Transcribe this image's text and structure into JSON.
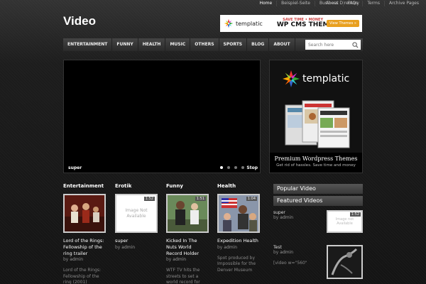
{
  "top_links": [
    "Home",
    "Beispiel-Seite",
    "Business Directory"
  ],
  "top_links_right": [
    "About",
    "FAQs",
    "Terms",
    "Archive Pages"
  ],
  "site_title": "Video",
  "banner": {
    "brand": "templatic",
    "tagline": "SAVE TIME • MONEY",
    "headline": "WP CMS THEM",
    "button": "View Themes »"
  },
  "nav": [
    "ENTERTAINMENT",
    "FUNNY",
    "HEALTH",
    "MUSIC",
    "OTHERS",
    "SPORTS",
    "BLOG",
    "ABOUT"
  ],
  "search": {
    "placeholder": "Search here"
  },
  "player": {
    "caption": "super",
    "stop": "Stop",
    "slide_count": 4,
    "active_slide": 1
  },
  "side_ad": {
    "brand": "templatic",
    "title": "Premium Wordpress Themes",
    "subtitle": "Get rid of hassles. Save time and money"
  },
  "columns": [
    {
      "category": "Entertainment",
      "duration": "",
      "title": "Lord of the Rings: Fellowship of the ring trailer",
      "author": "admin",
      "excerpt": "Lord of the Rings: Fellowship of the ring (2001)",
      "na": false
    },
    {
      "category": "Erotik",
      "duration": "1:52",
      "title": "super",
      "author": "admin",
      "excerpt": "",
      "na": true,
      "na_text": "Image Not Available"
    },
    {
      "category": "Funny",
      "duration": "1:51",
      "title": "Kicked In The Nuts World Record Holder",
      "author": "admin",
      "excerpt": "WTF TV hits the streets to set a world record for",
      "na": false
    },
    {
      "category": "Health",
      "duration": "1:04",
      "title": "Expedition Health",
      "author": "admin",
      "excerpt": "Spot produced by Impossible for the Denver Museum",
      "na": false
    }
  ],
  "by_label": "by",
  "sidebar": {
    "popular_title": "Popular Video",
    "featured_title": "Featured Videos",
    "items": [
      {
        "title": "super",
        "author": "admin",
        "duration": "1:52",
        "excerpt": "",
        "na_text": "Image not Available"
      },
      {
        "title": "Test",
        "author": "admin",
        "duration": "",
        "excerpt": "[video w=\"560\""
      }
    ]
  }
}
